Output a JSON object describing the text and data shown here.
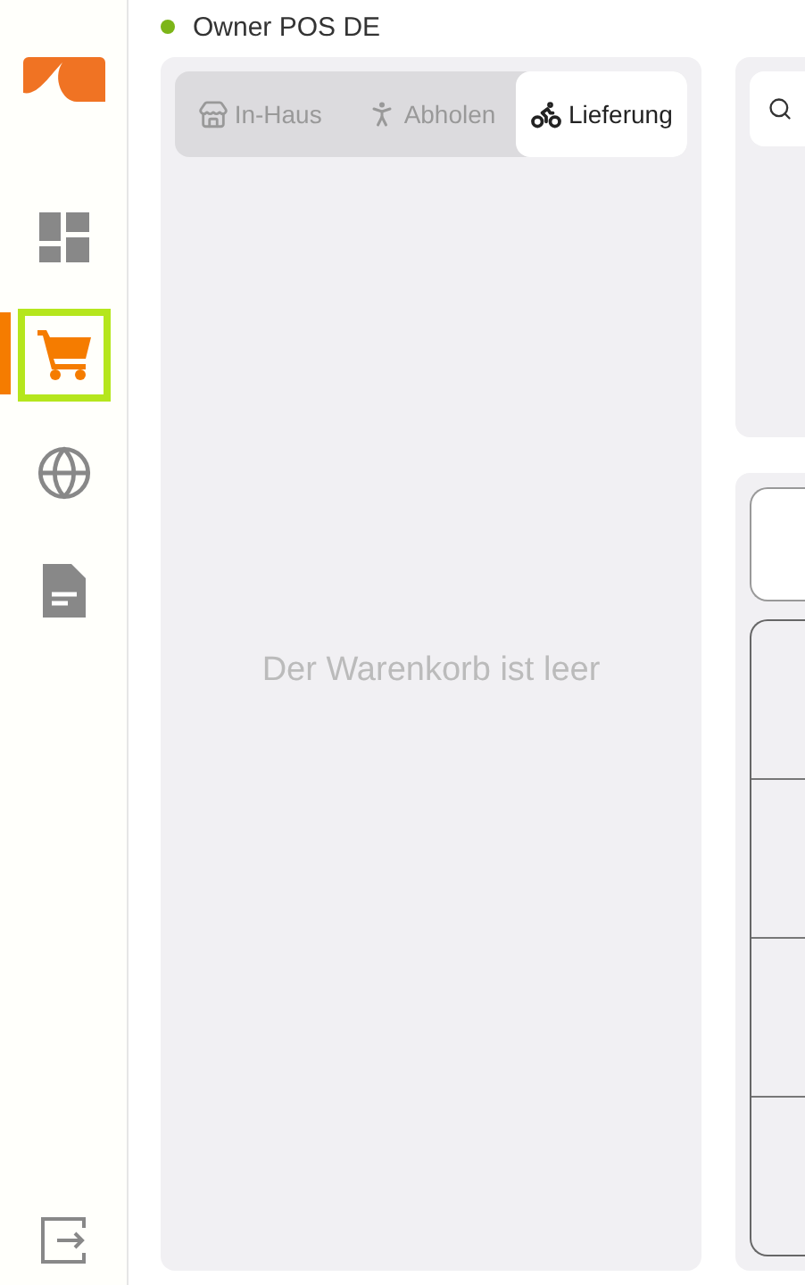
{
  "status": {
    "label": "Owner POS DE",
    "online": true
  },
  "nav": [
    {
      "kind": "dashboard",
      "selected": false
    },
    {
      "kind": "cart",
      "selected": true
    },
    {
      "kind": "globe",
      "selected": false
    },
    {
      "kind": "document",
      "selected": false
    }
  ],
  "tabs": [
    {
      "kind": "store",
      "label": "In-Haus",
      "selected": false
    },
    {
      "kind": "walk",
      "label": "Abholen",
      "selected": false
    },
    {
      "kind": "bike",
      "label": "Lieferung",
      "selected": true
    }
  ],
  "cart": {
    "empty_message": "Der Warenkorb ist leer"
  }
}
